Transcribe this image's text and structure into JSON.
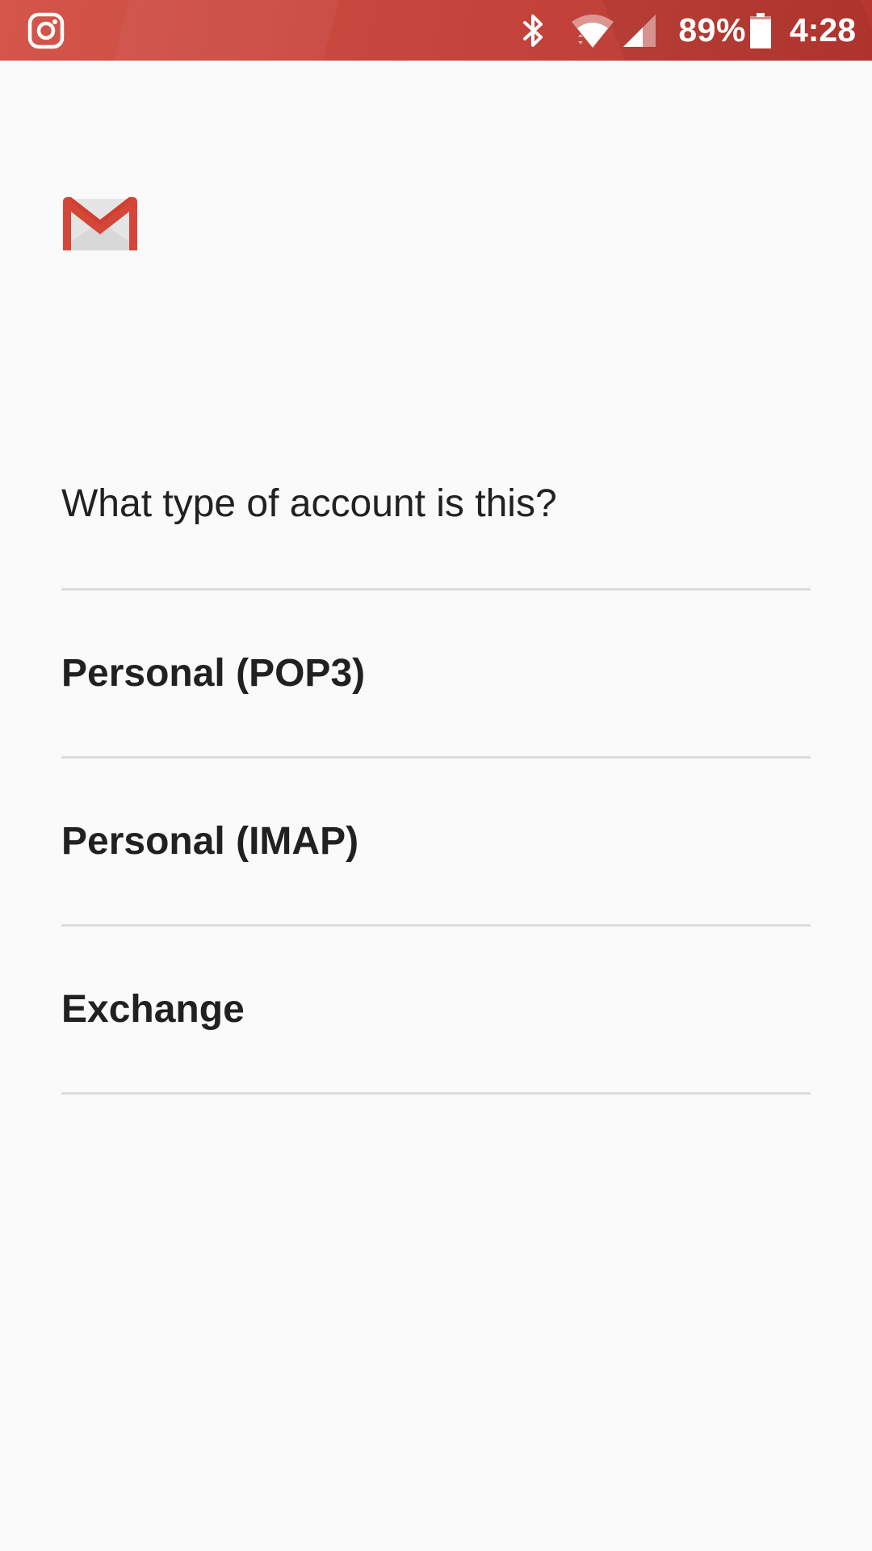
{
  "status_bar": {
    "notification_icon": "instagram-icon",
    "icons": [
      "bluetooth-icon",
      "wifi-icon",
      "cell-signal-icon",
      "battery-icon"
    ],
    "battery_percent": "89%",
    "time": "4:28"
  },
  "app": {
    "logo": "gmail-logo-icon"
  },
  "prompt": {
    "question": "What type of account is this?"
  },
  "account_types": [
    {
      "label": "Personal (POP3)"
    },
    {
      "label": "Personal (IMAP)"
    },
    {
      "label": "Exchange"
    }
  ],
  "colors": {
    "status_bar": "#c8473e",
    "background": "#fafafa",
    "text": "#212121",
    "divider": "#dcdcdc",
    "gmail_red": "#d44638"
  }
}
